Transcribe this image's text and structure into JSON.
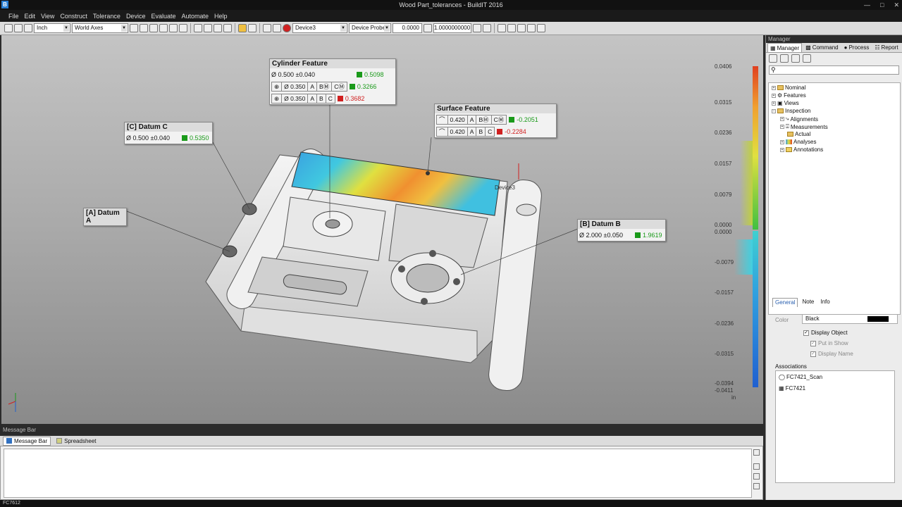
{
  "window": {
    "title": "Wood Part_tolerances - BuildIT 2016",
    "app_icon": "B"
  },
  "menu": [
    "File",
    "Edit",
    "View",
    "Construct",
    "Tolerance",
    "Device",
    "Evaluate",
    "Automate",
    "Help"
  ],
  "toolbar": {
    "units": "Inch",
    "axes": "World Axes",
    "device": "Device3",
    "probe": "Device Probe",
    "offset": "0.0000",
    "scale": "1.0000000000"
  },
  "callouts": {
    "cylinder": {
      "title": "Cylinder Feature",
      "size": "Ø  0.500 ±0.040",
      "size_val": "0.5098",
      "r1": {
        "dia": "Ø 0.350",
        "d1": "A",
        "d2": "BⓂ",
        "d3": "CⓂ",
        "val": "0.3266"
      },
      "r2": {
        "dia": "Ø 0.350",
        "d1": "A",
        "d2": "B",
        "d3": "C",
        "val": "0.3682"
      }
    },
    "surface": {
      "title": "Surface Feature",
      "r1": {
        "tol": "0.420",
        "d1": "A",
        "d2": "BⓂ",
        "d3": "CⓂ",
        "val": "-0.2051"
      },
      "r2": {
        "tol": "0.420",
        "d1": "A",
        "d2": "B",
        "d3": "C",
        "val": "-0.2284"
      }
    },
    "datumC": {
      "title": "[C] Datum C",
      "size": "Ø  0.500 ±0.040",
      "val": "0.5350"
    },
    "datumA": {
      "title": "[A] Datum A"
    },
    "datumB": {
      "title": "[B] Datum B",
      "size": "Ø  2.000 ±0.050",
      "val": "1.9619"
    }
  },
  "device_label": "Device3",
  "scale": {
    "labels": [
      "0.0406",
      "0.0315",
      "0.0236",
      "0.0157",
      "0.0079",
      "0.0000",
      "0.0000",
      "-0.0079",
      "-0.0157",
      "-0.0236",
      "-0.0315",
      "-0.0394",
      "-0.0411",
      "in"
    ]
  },
  "message_bar": {
    "title": "Message Bar",
    "tabs": [
      "Message Bar",
      "Spreadsheet"
    ]
  },
  "status": "FC7612",
  "manager": {
    "title": "Manager",
    "tabs": [
      "Manager",
      "Command",
      "Process",
      "Report"
    ],
    "tree": [
      "Nominal",
      "Features",
      "Views",
      "Inspection",
      "Alignments",
      "Measurements",
      "Actual",
      "Analyses",
      "Annotations"
    ],
    "prop_tabs": [
      "General",
      "Note",
      "Info"
    ],
    "color_label": "Color",
    "color_value": "Black",
    "display_object": "Display Object",
    "put_in_show": "Put in Show",
    "display_name": "Display Name",
    "associations": "Associations",
    "assoc": [
      "FC7421_Scan",
      "FC7421"
    ]
  },
  "colors": {
    "green": "#1a9a1a",
    "red": "#d02020"
  }
}
